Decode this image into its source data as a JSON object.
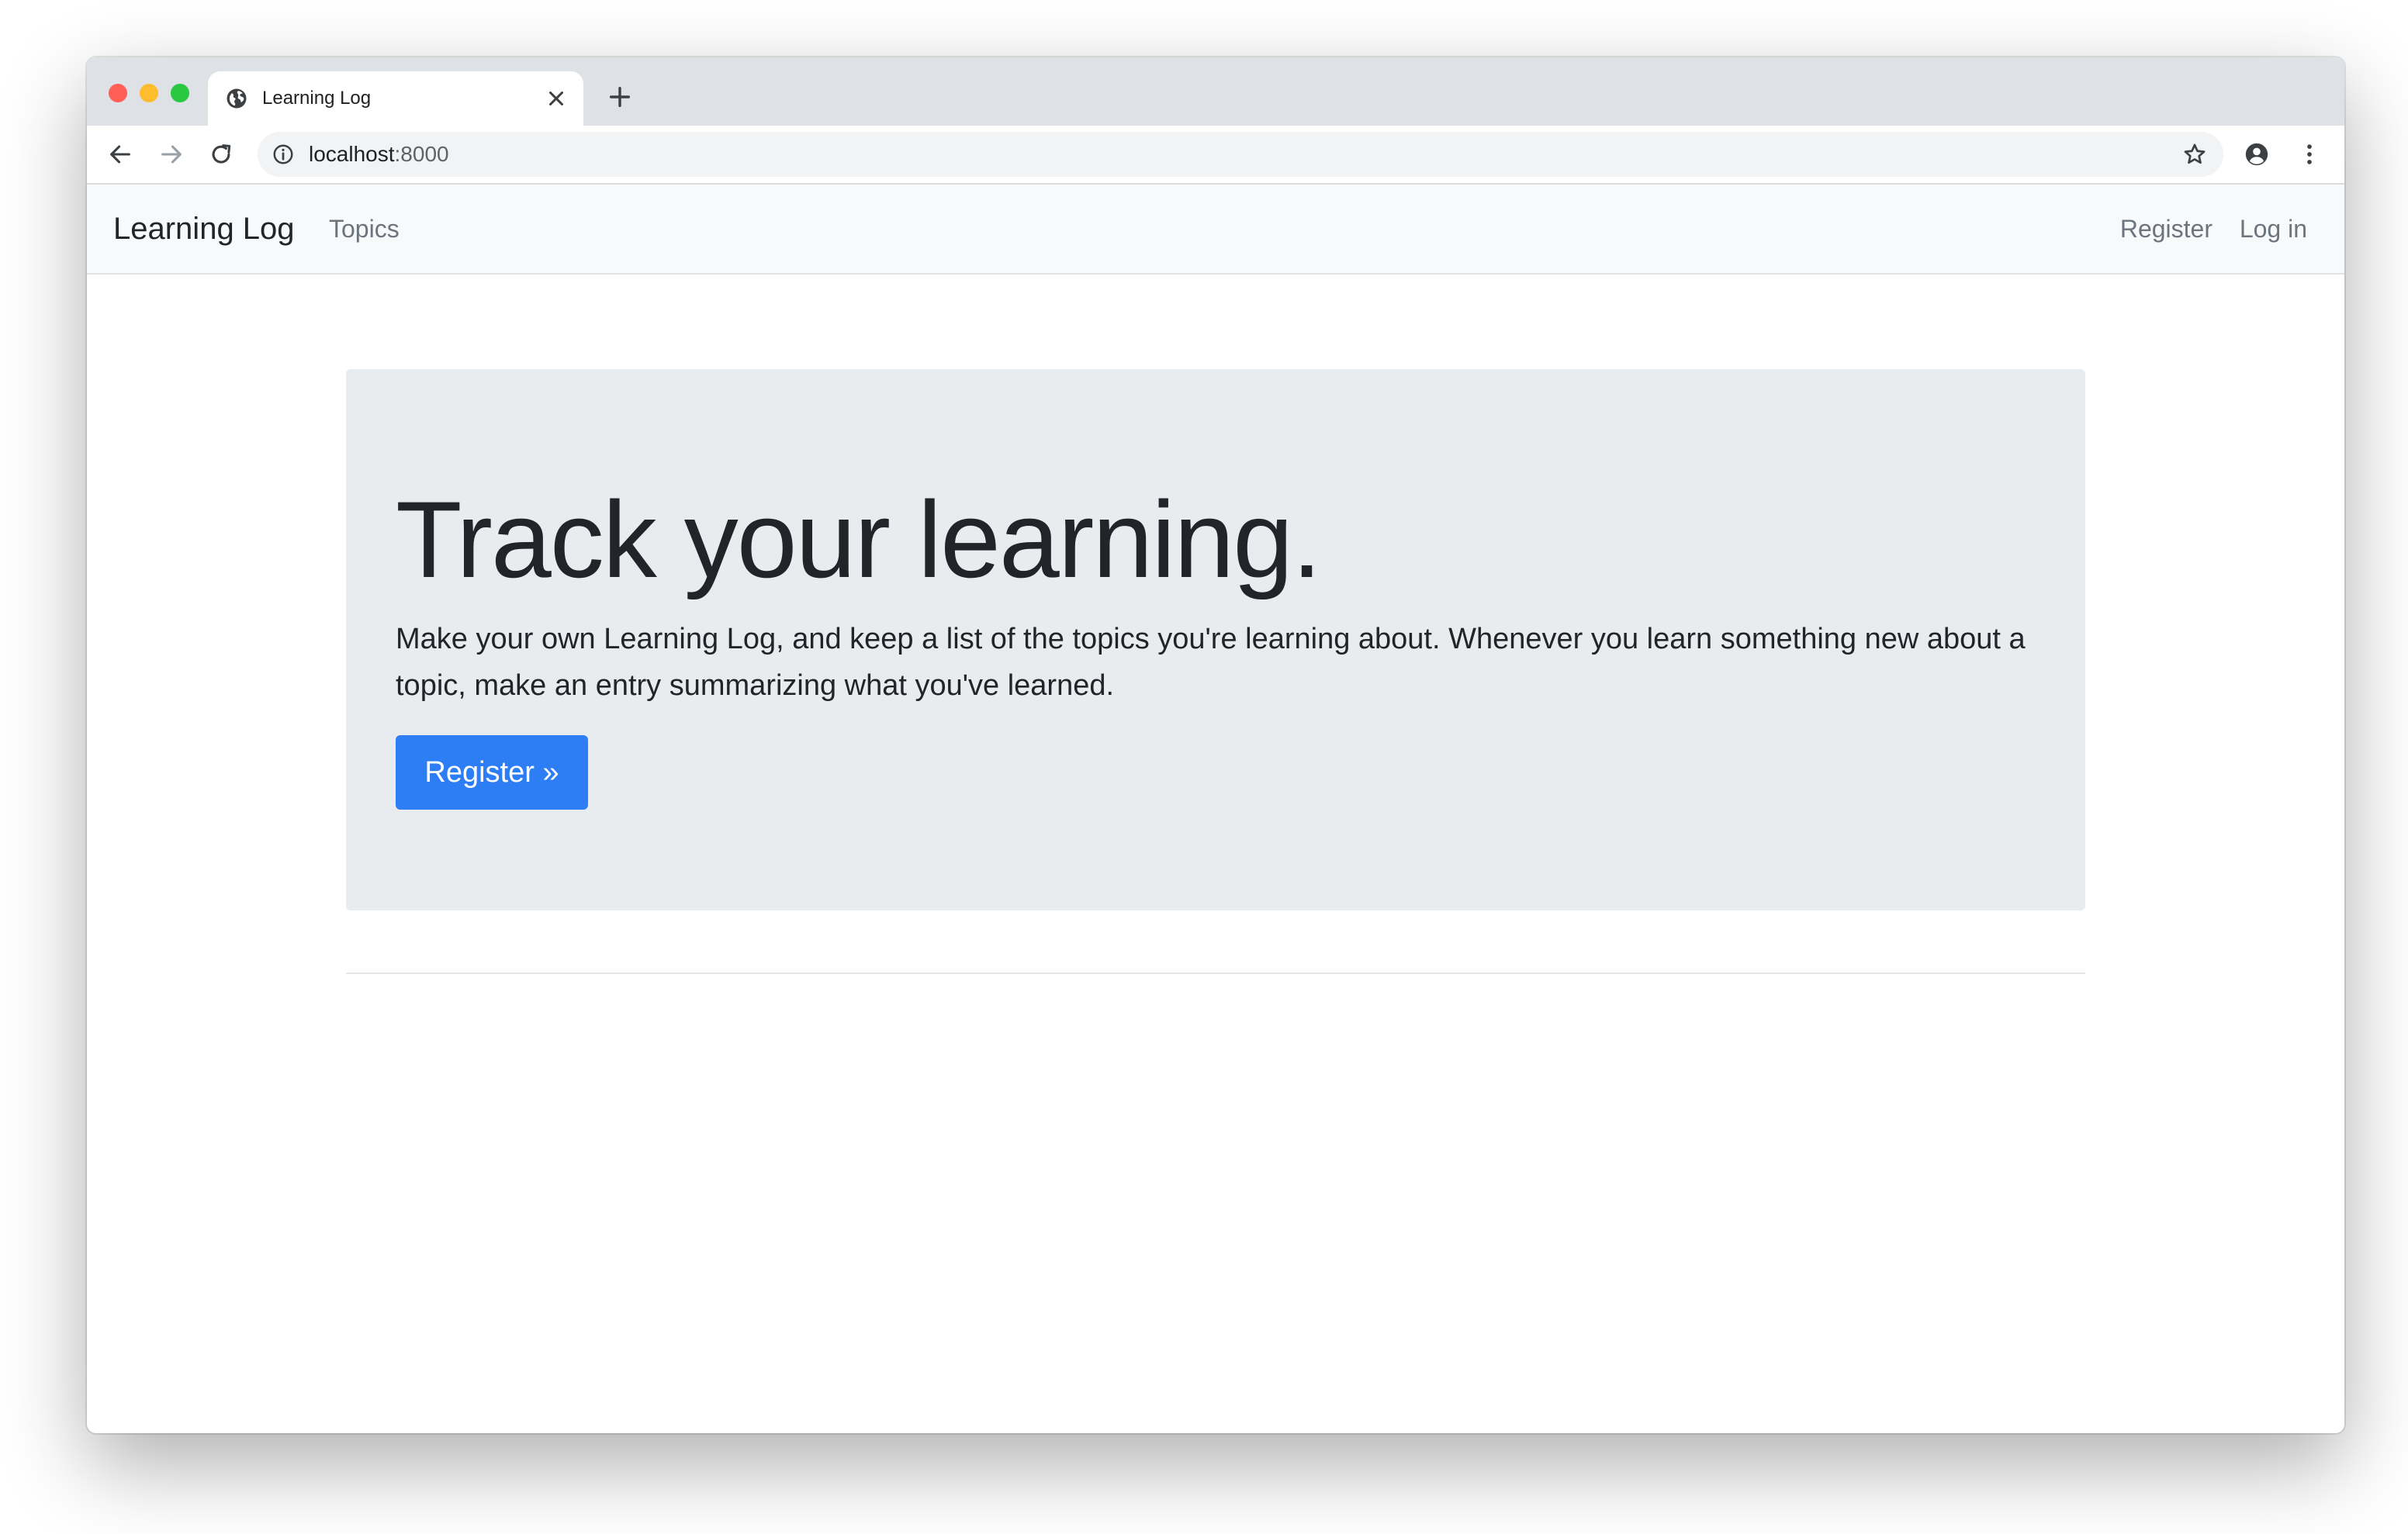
{
  "browser": {
    "tab": {
      "title": "Learning Log",
      "icon": "globe-icon",
      "close_icon": "close-icon"
    },
    "new_tab_icon": "plus-icon",
    "toolbar": {
      "back_icon": "arrow-left-icon",
      "forward_icon": "arrow-right-icon",
      "reload_icon": "reload-icon",
      "address": {
        "host": "localhost",
        "port": ":8000",
        "info_icon": "info-icon",
        "bookmark_icon": "star-icon"
      },
      "profile_icon": "account-circle-icon",
      "menu_icon": "more-vertical-icon"
    }
  },
  "navbar": {
    "brand": "Learning Log",
    "links": {
      "topics": "Topics",
      "register": "Register",
      "login": "Log in"
    },
    "background": "#f8f9fa"
  },
  "jumbotron": {
    "heading": "Track your learning.",
    "lead": "Make your own Learning Log, and keep a list of the topics you're learning about. Whenever you learn something new about a topic, make an entry summarizing what you've learned.",
    "button_label": "Register »",
    "button_color": "#2d7df4",
    "background": "#e9ecef"
  }
}
